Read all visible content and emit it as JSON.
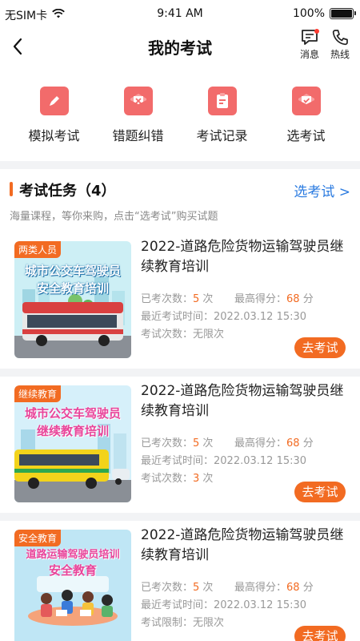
{
  "status": {
    "carrier": "无SIM卡",
    "time": "9:41 AM",
    "battery": "100%"
  },
  "nav": {
    "title": "我的考试",
    "msg_label": "消息",
    "hotline_label": "热线"
  },
  "quick_actions": [
    {
      "label": "模拟考试",
      "icon": "pencil-icon",
      "color": "#f26b6b"
    },
    {
      "label": "错题纠错",
      "icon": "mail-error-icon",
      "color": "#f26b6b"
    },
    {
      "label": "考试记录",
      "icon": "clipboard-icon",
      "color": "#f26b6b"
    },
    {
      "label": "选考试",
      "icon": "mail-check-icon",
      "color": "#f26b6b"
    }
  ],
  "section": {
    "title": "考试任务（4）",
    "link": "选考试 >",
    "subtitle": "海量课程，等你来购，点击“选考试”购买试题"
  },
  "cards": [
    {
      "tag": "两类人员",
      "thumb_text1": "城市公交车驾驶员",
      "thumb_text2": "安全教育培训",
      "title": "2022-道路危险货物运输驾驶员继续教育培训",
      "taken_label": "已考次数：",
      "taken": "5",
      "taken_unit": " 次",
      "best_label": "最高得分：",
      "best": "68",
      "best_unit": " 分",
      "last_time": "最近考试时间：2022.03.12  15:30",
      "limit_label": "考试次数：",
      "limit": "无限次",
      "limit_highlight": false,
      "button": "去考试"
    },
    {
      "tag": "继续教育",
      "thumb_text1": "城市公交车驾驶员",
      "thumb_text2": "继续教育培训",
      "title": "2022-道路危险货物运输驾驶员继续教育培训",
      "taken_label": "已考次数：",
      "taken": "5",
      "taken_unit": " 次",
      "best_label": "最高得分：",
      "best": "68",
      "best_unit": " 分",
      "last_time": "最近考试时间：2022.03.12  15:30",
      "limit_label": "考试次数：",
      "limit": "3",
      "limit_unit": " 次",
      "limit_highlight": true,
      "button": "去考试"
    },
    {
      "tag": "安全教育",
      "thumb_text1": "道路运输驾驶员培训",
      "thumb_text2": "安全教育",
      "title": "2022-道路危险货物运输驾驶员继续教育培训",
      "taken_label": "已考次数：",
      "taken": "5",
      "taken_unit": " 次",
      "best_label": "最高得分：",
      "best": "68",
      "best_unit": " 分",
      "last_time": "最近考试时间：2022.03.12  15:30",
      "limit_label": "考试限制：",
      "limit": "无限次",
      "limit_highlight": false,
      "button": "去考试"
    }
  ]
}
